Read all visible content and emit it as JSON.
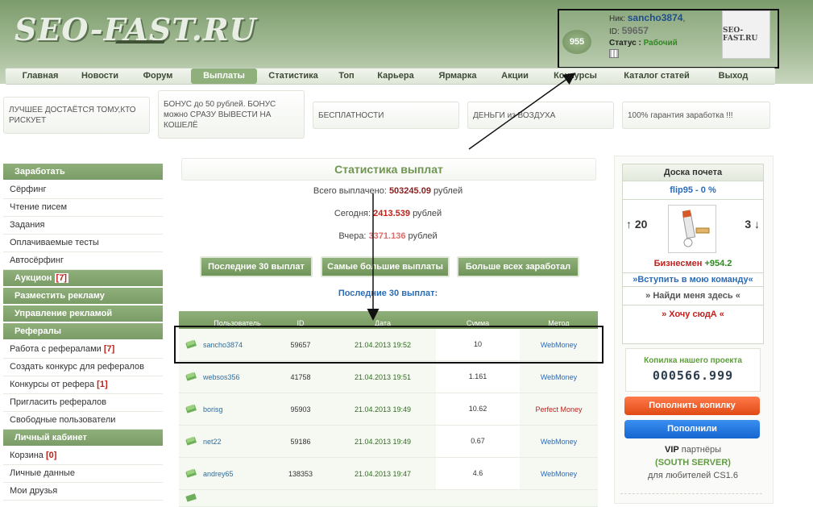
{
  "header": {
    "logo_text": "SEO-FAST.RU"
  },
  "user": {
    "points": "955",
    "nick_label": "Ник:",
    "nick": "sancho3874",
    "nick_suffix": ",",
    "id_label": "ID:",
    "id": "59657",
    "status_label": "Статус :",
    "status": "Рабочий",
    "avatar_text": "SEO-FAST.RU"
  },
  "nav": {
    "items": [
      "Главная",
      "Новости",
      "Форум",
      "Выплаты",
      "Статистика",
      "Топ",
      "Карьера",
      "Ярмарка",
      "Акции",
      "Конкурсы",
      "Каталог статей",
      "Выход"
    ],
    "active_index": 3
  },
  "banners": [
    "ЛУЧШЕЕ ДОСТАЁТСЯ ТОМУ,КТО РИСКУЕТ",
    "БОНУС до 50 рублей. БОНУС можно СРАЗУ ВЫВЕСТИ НА КОШЕЛЁ",
    "БЕСПЛАТНОСТИ",
    "ДЕНЬГИ из ВОЗДУХА",
    "100% гарантия заработка !!!"
  ],
  "sidebar": {
    "earn": "Заработать",
    "earn_items": [
      "Сёрфинг",
      "Чтение писем",
      "Задания",
      "Оплачиваемые тесты",
      "Автосёрфинг"
    ],
    "auction": "Аукцион",
    "auction_count": "[7]",
    "place_ads": "Разместить рекламу",
    "manage_ads": "Управление рекламой",
    "referrals": "Рефералы",
    "ref_work": "Работа с рефералами",
    "ref_work_count": "[7]",
    "ref_items": [
      "Создать конкурс для рефералов"
    ],
    "ref_contests": "Конкурсы от рефера",
    "ref_contests_count": "[1]",
    "ref_items2": [
      "Пригласить рефералов",
      "Свободные пользователи"
    ],
    "cabinet": "Личный кабинет",
    "cart": "Корзина",
    "cart_count": "[0]",
    "cab_items": [
      "Личные данные",
      "Мои друзья"
    ]
  },
  "stats": {
    "title": "Статистика выплат",
    "total_label": "Всего выплачено:",
    "total_value": "503245.09",
    "total_unit": "рублей",
    "today_label": "Сегодня:",
    "today_value": "2413.539",
    "today_unit": "рублей",
    "yesterday_label": "Вчера:",
    "yesterday_value": "3371.136",
    "yesterday_unit": "рублей",
    "btn_last30": "Последние 30 выплат",
    "btn_biggest": "Самые большие выплаты",
    "btn_most_earned": "Больше всех заработал",
    "last30_title": "Последние 30 выплат:"
  },
  "table": {
    "headers": [
      "Пользователь",
      "ID",
      "Дата",
      "Сумма",
      "Метод"
    ],
    "rows": [
      {
        "user": "sancho3874",
        "id": "59657",
        "date": "21.04.2013 19:52",
        "sum": "10",
        "method": "WebMoney"
      },
      {
        "user": "websos356",
        "id": "41758",
        "date": "21.04.2013 19:51",
        "sum": "1.161",
        "method": "WebMoney"
      },
      {
        "user": "borisg",
        "id": "95903",
        "date": "21.04.2013 19:49",
        "sum": "10.62",
        "method": "Perfect Money"
      },
      {
        "user": "net22",
        "id": "59186",
        "date": "21.04.2013 19:49",
        "sum": "0.67",
        "method": "WebMoney"
      },
      {
        "user": "andrey65",
        "id": "138353",
        "date": "21.04.2013 19:47",
        "sum": "4.6",
        "method": "WebMoney"
      }
    ]
  },
  "honor": {
    "title": "Доска почета",
    "user": "flip95 - 0 %",
    "up": "↑ 20",
    "down": "3 ↓",
    "rank": "Бизнесмен",
    "rank_value": "+954.2",
    "join_team": "»Вступить в мою команду«",
    "find_me": "» Найди меня здесь «",
    "want_here": "» Хочу сюдА «"
  },
  "kopilka": {
    "title": "Копилка нашего проекта",
    "value": "000566.999",
    "btn_fill": "Пополнить копилку",
    "btn_filled": "Пополнили"
  },
  "vip": {
    "vip": "VIP",
    "partners": " партнёры",
    "server": "(SOUTH SERVER)",
    "for": "для любителей CS1.6"
  },
  "colors": {
    "accent_green": "#7a9c67",
    "link_blue": "#2b6bb5",
    "red": "#c0211c"
  }
}
